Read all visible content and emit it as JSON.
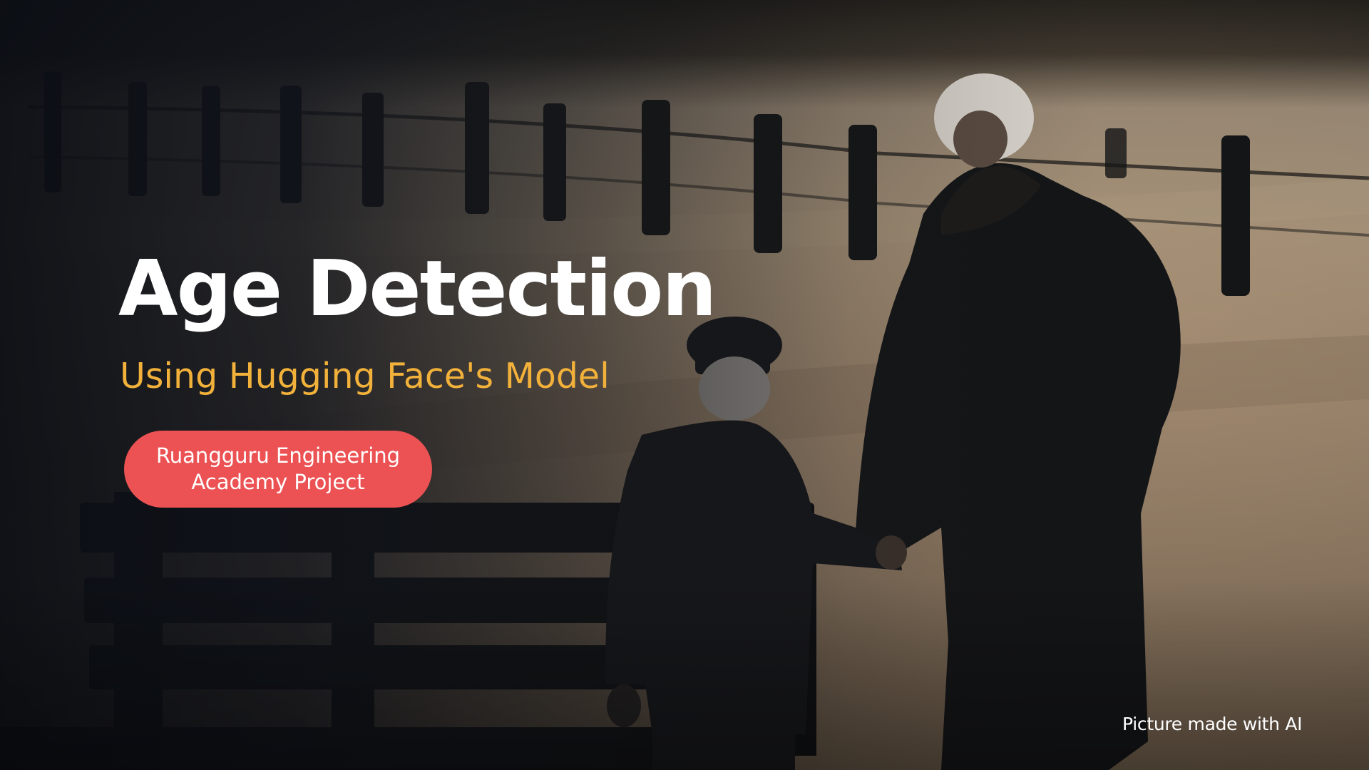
{
  "slide": {
    "title": "Age Detection",
    "subtitle": "Using Hugging Face's Model",
    "badge": {
      "line1": "Ruangguru Engineering",
      "line2": "Academy Project"
    },
    "credit": "Picture made with AI"
  },
  "colors": {
    "title": "#ffffff",
    "subtitle": "#f2b13a",
    "badge_background": "#ec5253",
    "badge_text": "#ffffff",
    "credit": "#ffffff",
    "photo_ground": "#8d7c68",
    "photo_shadow": "#121418"
  },
  "background": {
    "description_icon": "photo-scene-elder-and-child"
  }
}
